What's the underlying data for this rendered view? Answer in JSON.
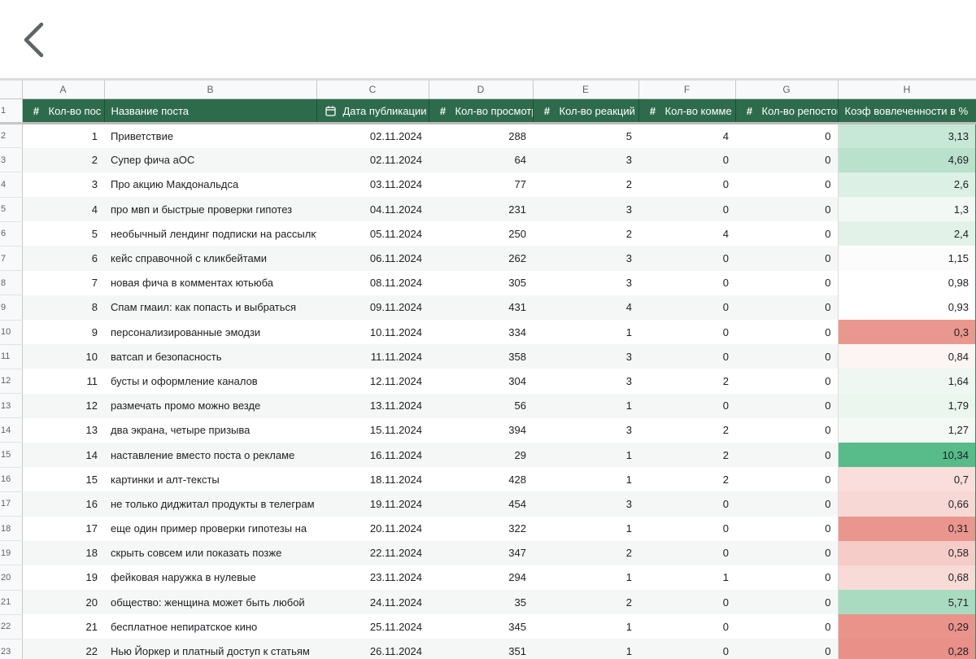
{
  "nav": {
    "back_icon": "chevron-left-icon"
  },
  "colors": {
    "header_bg": "#2e6b4d",
    "header_text": "#ffffff",
    "green_strong": "#57bb8a",
    "red_strong": "#e67c73"
  },
  "sheet": {
    "column_letters": [
      "A",
      "B",
      "C",
      "D",
      "E",
      "F",
      "G",
      "H"
    ],
    "headers": [
      {
        "icon": "#",
        "label": "Кол-во пос"
      },
      {
        "icon": "",
        "label": "Название поста"
      },
      {
        "icon": "calendar",
        "label": "Дата публикации"
      },
      {
        "icon": "#",
        "label": "Кол-во просмотров"
      },
      {
        "icon": "#",
        "label": "Кол-во реакций"
      },
      {
        "icon": "#",
        "label": "Кол-во комме"
      },
      {
        "icon": "#",
        "label": "Кол-во репостов"
      },
      {
        "icon": "",
        "label": "Коэф вовлеченности в %"
      }
    ],
    "row_numbers": [
      "1",
      "2",
      "3",
      "4",
      "5",
      "6",
      "7",
      "8",
      "9",
      "10",
      "11",
      "12",
      "13",
      "14",
      "15",
      "16",
      "17",
      "18",
      "19",
      "20",
      "21",
      "22",
      "23"
    ],
    "rows": [
      {
        "n": "1",
        "title": "Приветствие",
        "date": "02.11.2024",
        "views": "288",
        "reactions": "5",
        "comments": "4",
        "reposts": "0",
        "rate": "3,13",
        "rate_color": "#c7e8d7"
      },
      {
        "n": "2",
        "title": "Супер фича аОС",
        "date": "02.11.2024",
        "views": "64",
        "reactions": "3",
        "comments": "0",
        "reposts": "0",
        "rate": "4,69",
        "rate_color": "#b9e1cc"
      },
      {
        "n": "3",
        "title": "Про акцию Макдональдса",
        "date": "03.11.2024",
        "views": "77",
        "reactions": "2",
        "comments": "0",
        "reposts": "0",
        "rate": "2,6",
        "rate_color": "#dcf0e5"
      },
      {
        "n": "4",
        "title": "про мвп и быстрые проверки гипотез",
        "date": "04.11.2024",
        "views": "231",
        "reactions": "3",
        "comments": "0",
        "reposts": "0",
        "rate": "1,3",
        "rate_color": "#f2f8f4"
      },
      {
        "n": "5",
        "title": "необычный лендинг подписки на рассылку",
        "date": "05.11.2024",
        "views": "250",
        "reactions": "2",
        "comments": "4",
        "reposts": "0",
        "rate": "2,4",
        "rate_color": "#e2f2e9"
      },
      {
        "n": "6",
        "title": "кейс справочной с кликбейтами",
        "date": "06.11.2024",
        "views": "262",
        "reactions": "3",
        "comments": "0",
        "reposts": "0",
        "rate": "1,15",
        "rate_color": "#fbfcfb"
      },
      {
        "n": "7",
        "title": "новая фича в комментах ютьюба",
        "date": "08.11.2024",
        "views": "305",
        "reactions": "3",
        "comments": "0",
        "reposts": "0",
        "rate": "0,98",
        "rate_color": "#ffffff"
      },
      {
        "n": "8",
        "title": "Спам гмаил: как попасть и выбраться",
        "date": "09.11.2024",
        "views": "431",
        "reactions": "4",
        "comments": "0",
        "reposts": "0",
        "rate": "0,93",
        "rate_color": "#ffffff"
      },
      {
        "n": "9",
        "title": "персонализированные эмодзи",
        "date": "10.11.2024",
        "views": "334",
        "reactions": "1",
        "comments": "0",
        "reposts": "0",
        "rate": "0,3",
        "rate_color": "#ea978f"
      },
      {
        "n": "10",
        "title": "ватсап и безопасность",
        "date": "11.11.2024",
        "views": "358",
        "reactions": "3",
        "comments": "0",
        "reposts": "0",
        "rate": "0,84",
        "rate_color": "#fdf5f4"
      },
      {
        "n": "11",
        "title": "бусты и оформление каналов",
        "date": "12.11.2024",
        "views": "304",
        "reactions": "3",
        "comments": "2",
        "reposts": "0",
        "rate": "1,64",
        "rate_color": "#eef7f1"
      },
      {
        "n": "12",
        "title": "размечать промо можно везде",
        "date": "13.11.2024",
        "views": "56",
        "reactions": "1",
        "comments": "0",
        "reposts": "0",
        "rate": "1,79",
        "rate_color": "#ebf6ef"
      },
      {
        "n": "13",
        "title": "два экрана, четыре призыва",
        "date": "15.11.2024",
        "views": "394",
        "reactions": "3",
        "comments": "2",
        "reposts": "0",
        "rate": "1,27",
        "rate_color": "#f4f9f6"
      },
      {
        "n": "14",
        "title": "наставление вместо поста о рекламе",
        "date": "16.11.2024",
        "views": "29",
        "reactions": "1",
        "comments": "2",
        "reposts": "0",
        "rate": "10,34",
        "rate_color": "#57bb8a"
      },
      {
        "n": "15",
        "title": "картинки и алт-тексты",
        "date": "18.11.2024",
        "views": "428",
        "reactions": "1",
        "comments": "2",
        "reposts": "0",
        "rate": "0,7",
        "rate_color": "#f9dedb"
      },
      {
        "n": "16",
        "title": "не только диджитал продукты в телеграм",
        "date": "19.11.2024",
        "views": "454",
        "reactions": "3",
        "comments": "0",
        "reposts": "0",
        "rate": "0,66",
        "rate_color": "#f8d8d5"
      },
      {
        "n": "17",
        "title": "еще один пример проверки гипотезы на",
        "date": "20.11.2024",
        "views": "322",
        "reactions": "1",
        "comments": "0",
        "reposts": "0",
        "rate": "0,31",
        "rate_color": "#ea968e"
      },
      {
        "n": "18",
        "title": "скрыть совсем или показать позже",
        "date": "22.11.2024",
        "views": "347",
        "reactions": "2",
        "comments": "0",
        "reposts": "0",
        "rate": "0,58",
        "rate_color": "#f5ccc8"
      },
      {
        "n": "19",
        "title": "фейковая наружка в нулевые",
        "date": "23.11.2024",
        "views": "294",
        "reactions": "1",
        "comments": "1",
        "reposts": "0",
        "rate": "0,68",
        "rate_color": "#f8dad7"
      },
      {
        "n": "20",
        "title": "общество: женщина может быть любой",
        "date": "24.11.2024",
        "views": "35",
        "reactions": "2",
        "comments": "0",
        "reposts": "0",
        "rate": "5,71",
        "rate_color": "#a9dbc1"
      },
      {
        "n": "21",
        "title": "бесплатное непиратское кино",
        "date": "25.11.2024",
        "views": "345",
        "reactions": "1",
        "comments": "0",
        "reposts": "0",
        "rate": "0,29",
        "rate_color": "#e9938b"
      },
      {
        "n": "22",
        "title": "Нью Йоркер и платный доступ к статьям",
        "date": "26.11.2024",
        "views": "351",
        "reactions": "1",
        "comments": "0",
        "reposts": "0",
        "rate": "0,28",
        "rate_color": "#e99088"
      }
    ]
  }
}
